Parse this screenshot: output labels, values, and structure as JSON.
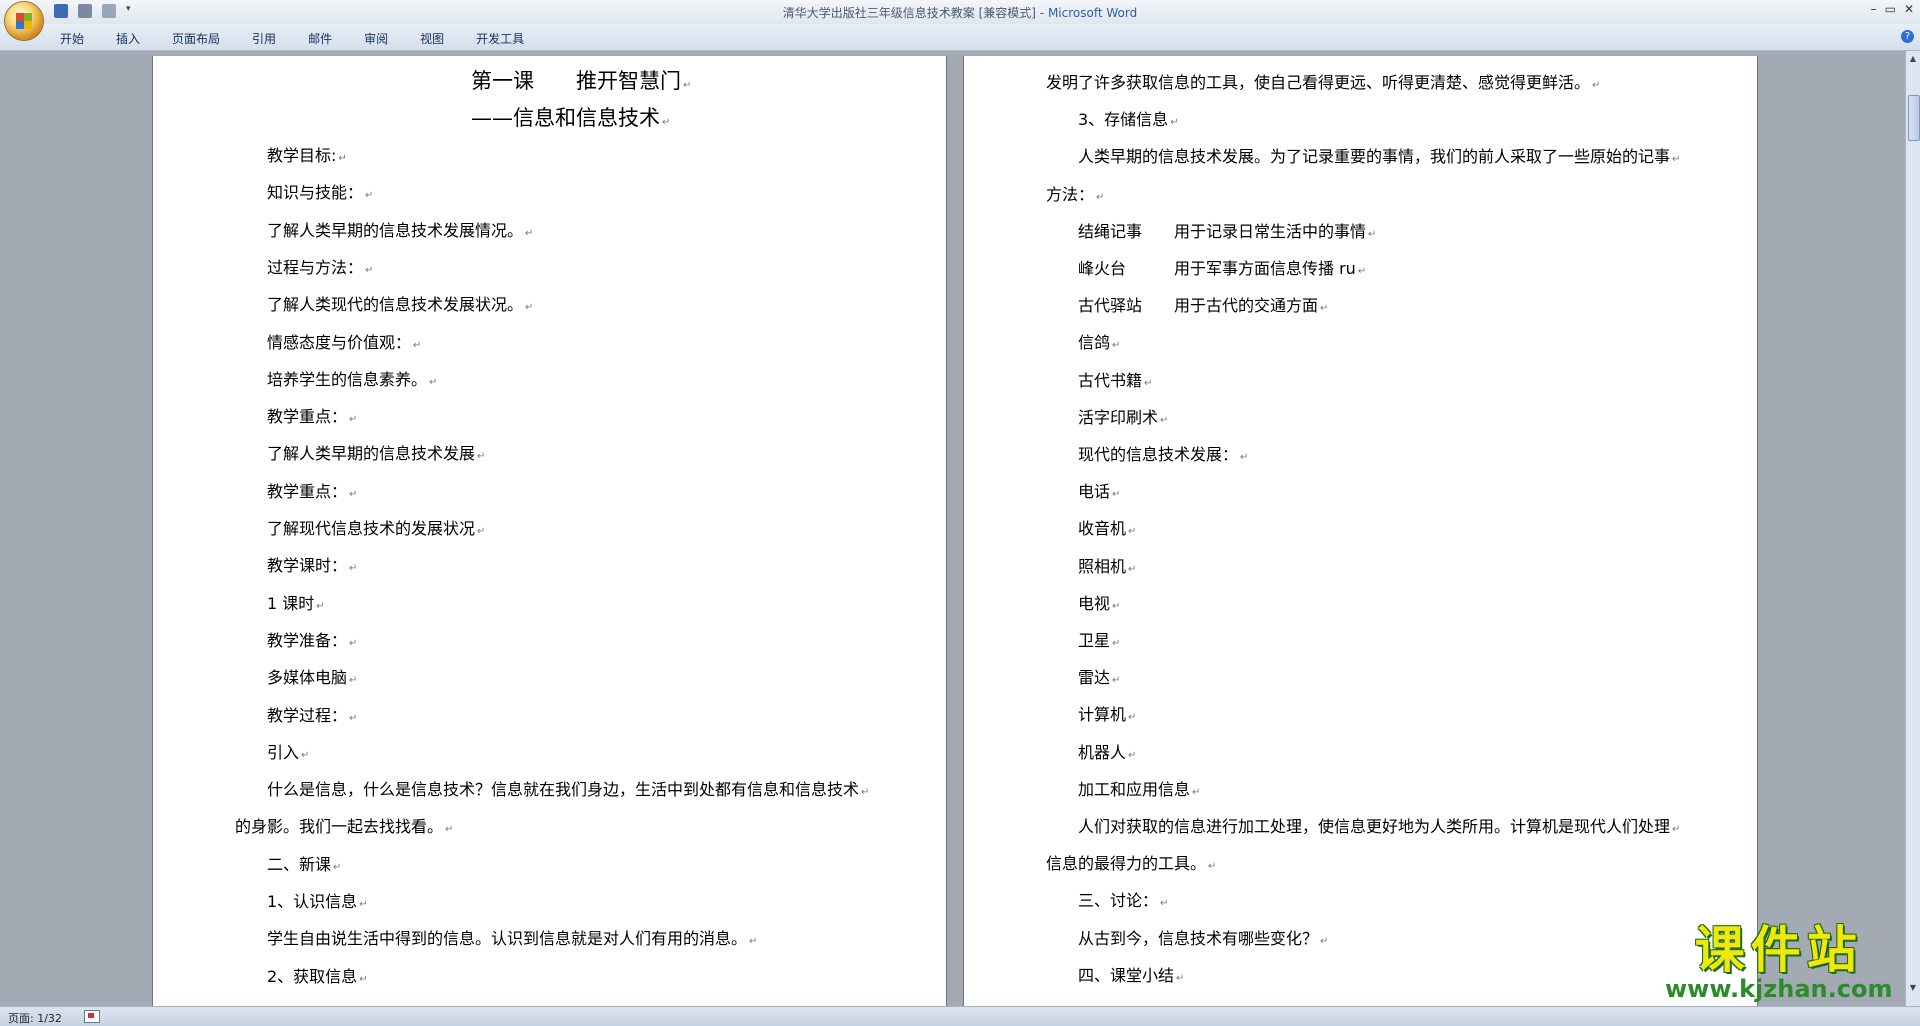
{
  "window": {
    "title": "清华大学出版社三年级信息技术教案 [兼容模式]",
    "title_sep": " - ",
    "app": "Microsoft Word"
  },
  "ribbon": {
    "tabs": [
      "开始",
      "插入",
      "页面布局",
      "引用",
      "邮件",
      "审阅",
      "视图",
      "开发工具"
    ],
    "help": "?"
  },
  "left_page": {
    "title": "第一课　　推开智慧门",
    "subtitle": "——信息和信息技术",
    "lines": [
      "教学目标:",
      "知识与技能：",
      "了解人类早期的信息技术发展情况。",
      "过程与方法：",
      "了解人类现代的信息技术发展状况。",
      "情感态度与价值观：",
      "培养学生的信息素养。",
      "教学重点：",
      "了解人类早期的信息技术发展",
      "教学重点：",
      "了解现代信息技术的发展状况",
      "教学课时：",
      "1 课时",
      "教学准备：",
      "多媒体电脑",
      "教学过程：",
      "引入",
      "什么是信息，什么是信息技术？信息就在我们身边，生活中到处都有信息和信息技术",
      "的身影。我们一起去找找看。",
      "二、新课",
      "1、认识信息",
      "学生自由说生活中得到的信息。认识到信息就是对人们有用的消息。",
      "2、获取信息"
    ]
  },
  "right_page": {
    "lines": [
      "发明了许多获取信息的工具，使自己看得更远、听得更清楚、感觉得更鲜活。",
      "3、存储信息",
      "人类早期的信息技术发展。为了记录重要的事情，我们的前人采取了一些原始的记事",
      "方法：",
      "结绳记事　　用于记录日常生活中的事情",
      "峰火台　　　用于军事方面信息传播 ru",
      "古代驿站　　用于古代的交通方面",
      "信鸽",
      "古代书籍",
      "活字印刷术",
      "现代的信息技术发展：",
      "电话",
      "收音机",
      "照相机",
      "电视",
      "卫星",
      "雷达",
      "计算机",
      "机器人",
      "加工和应用信息",
      "人们对获取的信息进行加工处理，使信息更好地为人类所用。计算机是现代人们处理",
      "信息的最得力的工具。",
      "三、讨论：",
      "从古到今，信息技术有哪些变化？",
      "四、课堂小结"
    ]
  },
  "paragraph_mark": "↵",
  "status": {
    "page": "页面: 1/32"
  },
  "watermark": {
    "top": "课件站",
    "bottom": "www.kjzhan.com"
  },
  "colors": {
    "accent": "#2b5fa8",
    "ribbon": "#d5dfeb",
    "watermark_yellow": "#f0e80c",
    "watermark_green": "#2c8b2a"
  }
}
